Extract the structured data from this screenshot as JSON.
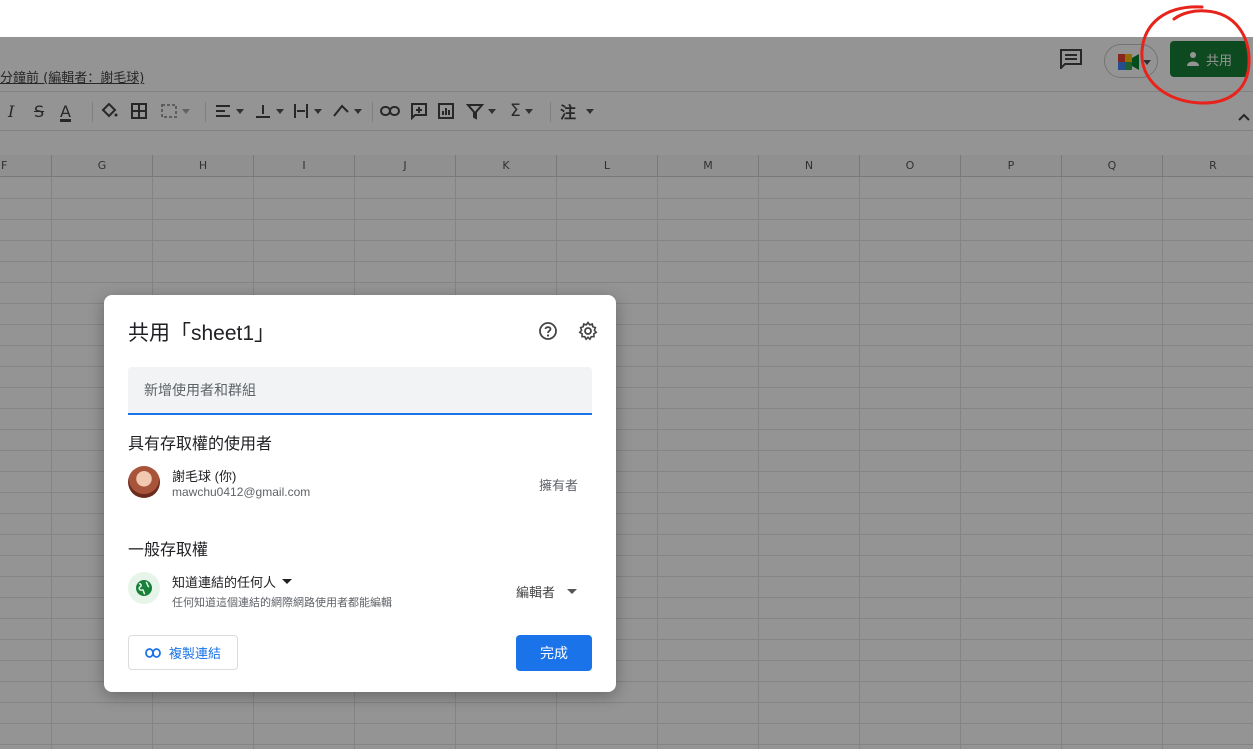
{
  "header": {
    "last_edit": "分鐘前 (編輯者：謝毛球)",
    "share_label": "共用",
    "comment_icon": "comment-icon",
    "meet_icon": "google-meet-icon"
  },
  "toolbar": {
    "font_menu": "注"
  },
  "grid": {
    "columns": [
      "F",
      "G",
      "H",
      "I",
      "J",
      "K",
      "L",
      "M",
      "N",
      "O",
      "P",
      "Q",
      "R"
    ]
  },
  "dialog": {
    "title": "共用「sheet1」",
    "add_placeholder": "新增使用者和群組",
    "people_section": "具有存取權的使用者",
    "user": {
      "name": "謝毛球 (你)",
      "email": "mawchu0412@gmail.com",
      "role": "擁有者"
    },
    "general_section": "一般存取權",
    "general": {
      "link_option": "知道連結的任何人",
      "description": "任何知道這個連結的網際網路使用者都能編輯",
      "permission": "編輯者"
    },
    "copy_link": "複製連結",
    "done": "完成"
  },
  "annotation": {
    "color": "#e8231c"
  }
}
